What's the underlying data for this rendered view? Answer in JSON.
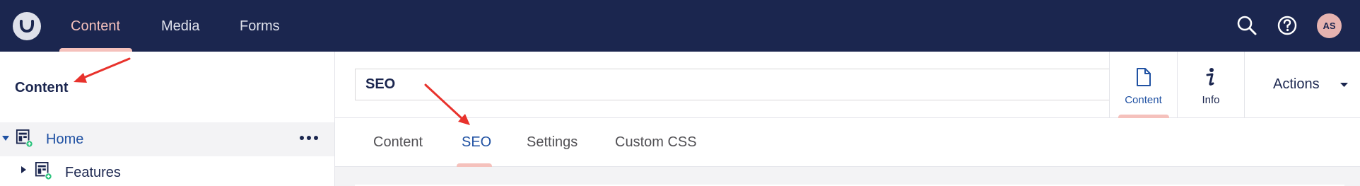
{
  "topbar": {
    "nav": [
      {
        "label": "Content",
        "active": true
      },
      {
        "label": "Media",
        "active": false
      },
      {
        "label": "Forms",
        "active": false
      }
    ],
    "icons": [
      "search-icon",
      "help-icon"
    ],
    "avatar_initials": "AS"
  },
  "sidebar": {
    "title": "Content",
    "tree": [
      {
        "label": "Home",
        "expanded": true,
        "icon": "document-icon"
      },
      {
        "label": "Features",
        "expanded": false,
        "icon": "document-icon"
      }
    ]
  },
  "editor": {
    "name_value": "SEO",
    "apps": [
      {
        "label": "Content",
        "icon": "document-icon",
        "active": true
      },
      {
        "label": "Info",
        "icon": "info-icon",
        "active": false
      }
    ],
    "actions_label": "Actions",
    "tabs": [
      {
        "label": "Content",
        "active": false
      },
      {
        "label": "SEO",
        "active": true
      },
      {
        "label": "Settings",
        "active": false
      },
      {
        "label": "Custom CSS",
        "active": false
      }
    ]
  },
  "colors": {
    "topbar_bg": "#1b264f",
    "accent_pink": "#f5c1bc",
    "active_blue": "#2152a3",
    "annotation_red": "#e8322c"
  }
}
